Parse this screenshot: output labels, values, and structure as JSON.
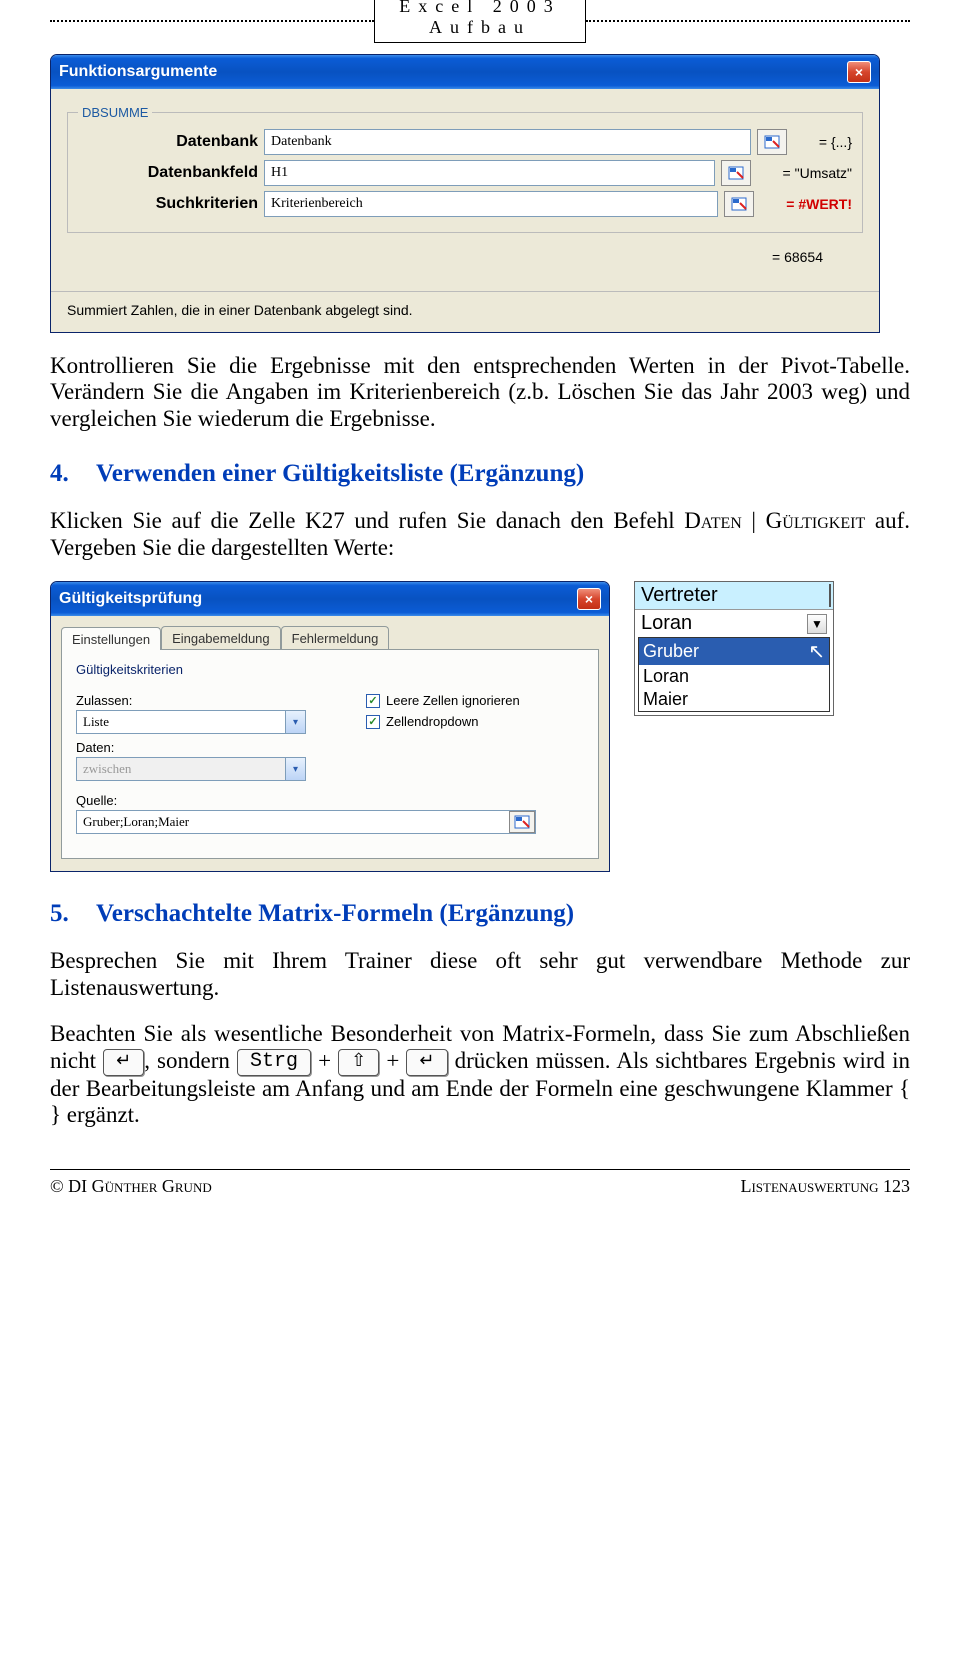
{
  "header": {
    "line1": "Excel 2003",
    "line2": "Aufbau"
  },
  "dialog1": {
    "title": "Funktionsargumente",
    "close": "×",
    "fn_name": "DBSUMME",
    "args": [
      {
        "label": "Datenbank",
        "value": "Datenbank",
        "eval": "= {...}"
      },
      {
        "label": "Datenbankfeld",
        "value": "H1",
        "eval": "= \"Umsatz\""
      },
      {
        "label": "Suchkriterien",
        "value": "Kriterienbereich",
        "eval": "= #WERT!",
        "err": true
      }
    ],
    "result": "= 68654",
    "desc": "Summiert Zahlen, die in einer Datenbank abgelegt sind."
  },
  "body": {
    "p1": "Kontrollieren Sie die Ergebnisse mit den entsprechenden Werten in der Pivot-Tabelle. Verändern Sie die Angaben im Kriterienbereich (z.b. Löschen Sie das Jahr 2003 weg) und vergleichen Sie wiederum die Ergebnisse."
  },
  "sec4": {
    "num": "4.",
    "title": "Verwenden einer Gültigkeitsliste (Ergänzung)",
    "p_pre": "Klicken Sie auf die Zelle K27 und rufen Sie danach den Befehl ",
    "cmd": "Daten | Gültigkeit",
    "p_post": " auf. Vergeben Sie die dargestellten Werte:"
  },
  "dialog2": {
    "title": "Gültigkeitsprüfung",
    "close": "×",
    "tabs": [
      "Einstellungen",
      "Eingabemeldung",
      "Fehlermeldung"
    ],
    "group": "Gültigkeitskriterien",
    "allow_label": "Zulassen:",
    "allow_value": "Liste",
    "data_label": "Daten:",
    "data_value": "zwischen",
    "chk1": "Leere Zellen ignorieren",
    "chk2": "Zellendropdown",
    "source_label": "Quelle:",
    "source_value": "Gruber;Loran;Maier"
  },
  "xl": {
    "header": "Vertreter",
    "cell": "Loran",
    "items": [
      "Gruber",
      "Loran",
      "Maier"
    ],
    "selected": 0
  },
  "sec5": {
    "num": "5.",
    "title": "Verschachtelte Matrix-Formeln (Ergänzung)",
    "p1": "Besprechen Sie mit Ihrem Trainer diese oft sehr gut verwendbare Methode zur Listenauswertung.",
    "p2a": "Beachten Sie als wesentliche Besonderheit von Matrix-Formeln, dass Sie zum Abschließen nicht ",
    "p2b": ", sondern ",
    "p2c": " drücken müssen. Als sichtbares Ergebnis wird in der Bearbeitungsleiste am Anfang und am Ende der Formeln eine geschwungene Klammer { } ergänzt.",
    "keys": {
      "enter": "↵",
      "ctrl": "Strg",
      "shift": "⇧",
      "enter2": "↵",
      "plus": "+"
    }
  },
  "footer": {
    "left_pre": "© DI G",
    "left_sc1": "ünther",
    "left_mid": " G",
    "left_sc2": "rund",
    "right_sc": "Listenauswertung",
    "right_page": " 123"
  }
}
